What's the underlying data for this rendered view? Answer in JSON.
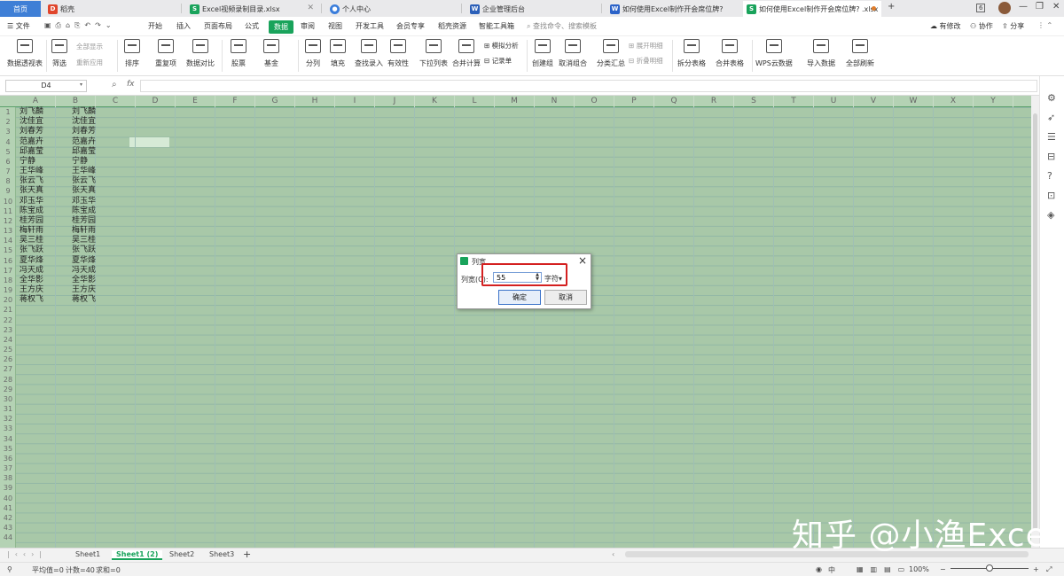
{
  "tabs": [
    {
      "label": "首页"
    },
    {
      "label": "稻壳",
      "icon": "daoke-icon"
    },
    {
      "label": "Excel视频录制目录.xlsx",
      "icon": "sheet-icon"
    },
    {
      "label": "个人中心",
      "icon": "user-icon"
    },
    {
      "label": "企业管理后台",
      "icon": "building-icon"
    },
    {
      "label": "如何使用Excel制作开会席位牌?",
      "icon": "doc-icon"
    },
    {
      "label": "如何使用Excel制作开会席位牌? .xlsx",
      "icon": "sheet-icon"
    }
  ],
  "win": {
    "count_badge": "6"
  },
  "menu": {
    "file": "文件",
    "items": [
      "开始",
      "插入",
      "页面布局",
      "公式",
      "数据",
      "审阅",
      "视图",
      "开发工具",
      "会员专享",
      "稻壳资源",
      "智能工具箱"
    ],
    "active": "数据",
    "search": "查找命令、搜索模板",
    "modify": "有修改",
    "collab": "协作",
    "share": "分享"
  },
  "ribbon": {
    "pivot": "数据透视表",
    "filter": "筛选",
    "show_all": "全部显示",
    "reapply": "重新应用",
    "sort": "排序",
    "dup": "重复项",
    "compare": "数据对比",
    "stock": "股票",
    "fund": "基金",
    "split": "分列",
    "fill": "填充",
    "lookup": "查找录入",
    "validity": "有效性",
    "dropdown": "下拉列表",
    "consolidate": "合并计算",
    "simulate": "模拟分析",
    "record": "记录单",
    "group": "创建组",
    "ungroup": "取消组合",
    "subtotal": "分类汇总",
    "expand": "展开明细",
    "collapse": "折叠明细",
    "split_table": "拆分表格",
    "merge_table": "合并表格",
    "wps_cloud": "WPS云数据",
    "import": "导入数据",
    "refresh": "全部刷新"
  },
  "formula_bar": {
    "name_box": "D4",
    "fx": "fx",
    "value": ""
  },
  "columns": [
    "A",
    "B",
    "C",
    "D",
    "E",
    "F",
    "G",
    "H",
    "I",
    "J",
    "K",
    "L",
    "M",
    "N",
    "O",
    "P",
    "Q",
    "R",
    "S",
    "T",
    "U",
    "V",
    "W",
    "X",
    "Y"
  ],
  "rows": [
    "1",
    "2",
    "3",
    "4",
    "5",
    "6",
    "7",
    "8",
    "9",
    "10",
    "11",
    "12",
    "13",
    "14",
    "15",
    "16",
    "17",
    "18",
    "19",
    "20",
    "21",
    "22",
    "23",
    "24",
    "25",
    "26",
    "27",
    "28",
    "29",
    "30",
    "31",
    "32",
    "33",
    "34",
    "35",
    "36",
    "37",
    "38",
    "39",
    "40",
    "41",
    "42",
    "43",
    "44"
  ],
  "names": [
    "刘飞麟",
    "沈佳宜",
    "刘春芳",
    "范嘉卉",
    "邱嘉莹",
    "宁静",
    "王华峰",
    "张云飞",
    "张天真",
    "邓玉华",
    "陈宝成",
    "桂芳园",
    "梅轩雨",
    "吴三桂",
    "张飞跃",
    "夏华烽",
    "冯天成",
    "全华影",
    "王方庆",
    "蒋权飞"
  ],
  "sheet_tabs": [
    "Sheet1",
    "Sheet1 (2)",
    "Sheet2",
    "Sheet3"
  ],
  "active_sheet": "Sheet1 (2)",
  "status": {
    "avg": "平均值=0",
    "count": "计数=40",
    "sum": "求和=0",
    "lang": "中",
    "zoom": "100%"
  },
  "dialog": {
    "title": "列宽",
    "label": "列宽(C):",
    "value": "55",
    "unit": "字符",
    "ok": "确定",
    "cancel": "取消"
  },
  "watermark": "知乎 @小渔Excel",
  "colors": {
    "accent": "#19a35b",
    "sheet_bg": "#a8c8a8",
    "highlight": "#d42020",
    "home_tab": "#3f7fd6"
  }
}
